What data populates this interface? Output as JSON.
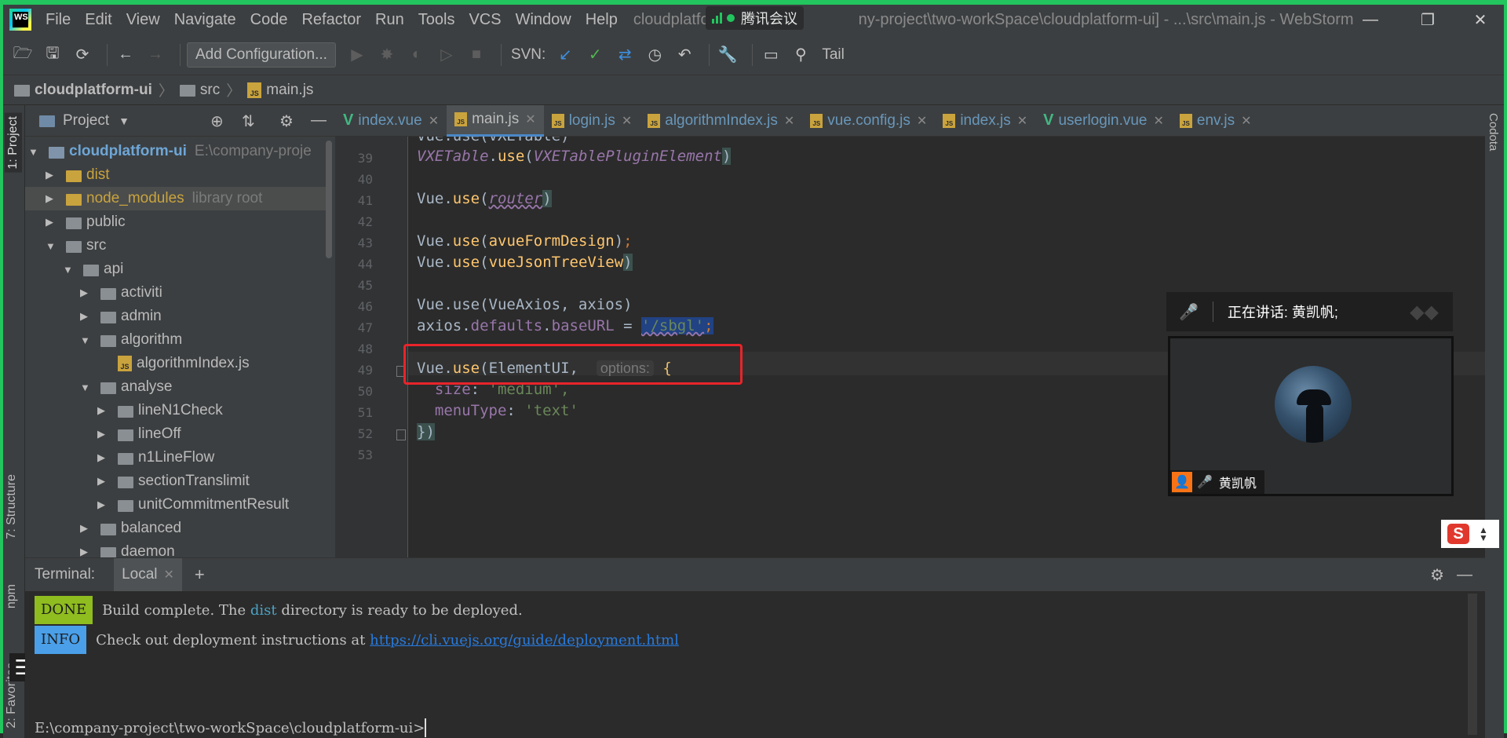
{
  "menubar": {
    "logo": "WS",
    "items": [
      "File",
      "Edit",
      "View",
      "Navigate",
      "Code",
      "Refactor",
      "Run",
      "Tools",
      "VCS",
      "Window",
      "Help"
    ],
    "title": "cloudplatform-ui [E:\\company-project\\two-workSpace\\cloudplatform-ui] - ...\\src\\main.js - WebStorm",
    "title_visible": "cloudplatfo",
    "title_visible_2": "ny-project\\two-workSpace\\cloudplatform-ui] - ...\\src\\main.js - WebStorm",
    "meeting_app": "腾讯会议"
  },
  "toolbar": {
    "add_config": "Add Configuration...",
    "svn_label": "SVN:",
    "tail_label": "Tail"
  },
  "breadcrumb": [
    "cloudplatform-ui",
    "src",
    "main.js"
  ],
  "project_panel": {
    "title": "Project",
    "tree": [
      {
        "label": "cloudplatform-ui",
        "extra": "E:\\company-proje",
        "type": "folder",
        "open": true
      },
      {
        "label": "dist",
        "type": "folder",
        "open": false
      },
      {
        "label": "node_modules",
        "extra": "library root",
        "type": "folder",
        "open": false
      },
      {
        "label": "public",
        "type": "folder",
        "open": false
      },
      {
        "label": "src",
        "type": "folder",
        "open": true
      },
      {
        "label": "api",
        "type": "folder",
        "open": true
      },
      {
        "label": "activiti",
        "type": "folder",
        "open": false
      },
      {
        "label": "admin",
        "type": "folder",
        "open": false
      },
      {
        "label": "algorithm",
        "type": "folder",
        "open": true
      },
      {
        "label": "algorithmIndex.js",
        "type": "js"
      },
      {
        "label": "analyse",
        "type": "folder",
        "open": true
      },
      {
        "label": "lineN1Check",
        "type": "folder",
        "open": false
      },
      {
        "label": "lineOff",
        "type": "folder",
        "open": false
      },
      {
        "label": "n1LineFlow",
        "type": "folder",
        "open": false
      },
      {
        "label": "sectionTranslimit",
        "type": "folder",
        "open": false
      },
      {
        "label": "unitCommitmentResult",
        "type": "folder",
        "open": false
      },
      {
        "label": "balanced",
        "type": "folder",
        "open": false
      },
      {
        "label": "daemon",
        "type": "folder",
        "open": false
      }
    ]
  },
  "tabs": [
    {
      "label": "index.vue",
      "type": "vue"
    },
    {
      "label": "main.js",
      "type": "js",
      "active": true
    },
    {
      "label": "login.js",
      "type": "js"
    },
    {
      "label": "algorithmIndex.js",
      "type": "js"
    },
    {
      "label": "vue.config.js",
      "type": "js"
    },
    {
      "label": "index.js",
      "type": "js"
    },
    {
      "label": "userlogin.vue",
      "type": "vue"
    },
    {
      "label": "env.js",
      "type": "js"
    }
  ],
  "editor": {
    "line_numbers": [
      "39",
      "40",
      "41",
      "42",
      "43",
      "44",
      "45",
      "46",
      "47",
      "48",
      "49",
      "50",
      "51",
      "52",
      "53"
    ],
    "code": {
      "l39_obj": "VXETable",
      "l39_fn": "use",
      "l39_arg": "VXETablePluginElement",
      "vue": "Vue",
      "use": "use",
      "l41_arg": "router",
      "l43_arg": "avueFormDesign",
      "l44_arg": "vueJsonTreeView",
      "l46_text": "Vue.use(VueAxios, axios)",
      "l47_obj": "axios",
      "l47_p1": "defaults",
      "l47_p2": "baseURL",
      "l47_str": "'/sbgl'",
      "l49_arg": "ElementUI,",
      "l49_hint": "options:",
      "l50_key": "size",
      "l50_val": "'medium',",
      "l51_key": "menuType",
      "l51_val": "'text'",
      "l52": "})"
    }
  },
  "meeting": {
    "speaking_label": "正在讲话: 黄凯帆;",
    "participant_name": "黄凯帆"
  },
  "terminal": {
    "title": "Terminal:",
    "tab": "Local",
    "done_badge": "DONE",
    "done_pre": "Build complete. The ",
    "done_dir": "dist",
    "done_post": " directory is ready to be deployed.",
    "info_badge": "INFO",
    "info_pre": "Check out deployment instructions at ",
    "info_link": "https://cli.vuejs.org/guide/deployment.html",
    "prompt": "E:\\company-project\\two-workSpace\\cloudplatform-ui>"
  },
  "side_tabs": {
    "project": "1: Project",
    "structure": "7: Structure",
    "npm": "npm",
    "favorites": "2: Favorites",
    "codota": "Codota"
  },
  "colors": {
    "border_accent": "#22c55e",
    "annotation_box": "#e8242a"
  }
}
